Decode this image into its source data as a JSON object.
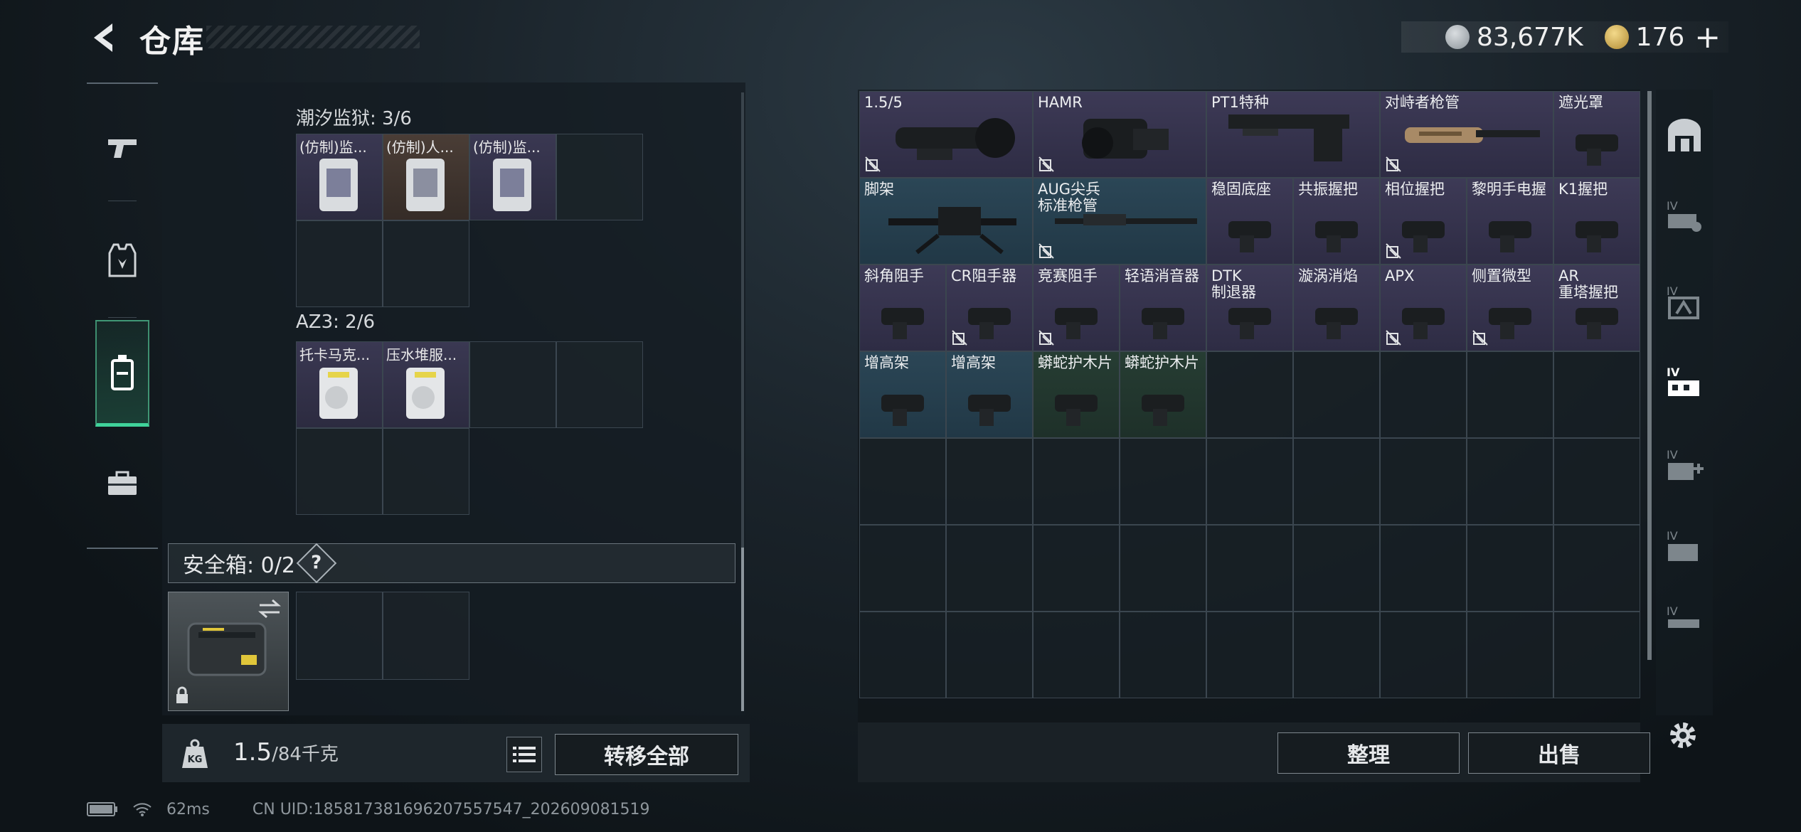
{
  "header": {
    "title": "仓库",
    "currency_1": "83,677K",
    "currency_2": "176",
    "plus": "+"
  },
  "left_rail": {
    "items": [
      {
        "name": "weapons",
        "icon": "pistol-icon"
      },
      {
        "name": "equipment",
        "icon": "vest-icon"
      },
      {
        "name": "backpack",
        "icon": "backpack-icon",
        "active": true
      },
      {
        "name": "cases",
        "icon": "toolbox-icon"
      }
    ]
  },
  "storage": {
    "section_1": {
      "title": "潮汐监狱: 3/6",
      "items": [
        {
          "label": "(仿制)监..."
        },
        {
          "label": "(仿制)人..."
        },
        {
          "label": "(仿制)监..."
        }
      ]
    },
    "section_2": {
      "title": "AZ3: 2/6",
      "items": [
        {
          "label": "托卡马克..."
        },
        {
          "label": "压水堆服..."
        }
      ]
    },
    "safe_box": {
      "label": "安全箱: 0/2",
      "help": "?"
    }
  },
  "footer_left": {
    "weight": "1.5",
    "capacity": "/84千克",
    "transfer_all": "转移全部"
  },
  "status": {
    "ping": "62ms",
    "uid": "CN UID:185817381696207557547_202609081519"
  },
  "inventory": {
    "items": [
      {
        "label": "1.5/5",
        "color": "purple",
        "span": 2,
        "locked": true
      },
      {
        "label": "HAMR",
        "color": "purple",
        "span": 2,
        "locked": true
      },
      {
        "label": "PT1特种",
        "color": "purple",
        "span": 2,
        "locked": false
      },
      {
        "label": "对峙者枪管",
        "color": "purple",
        "span": 2,
        "locked": true
      },
      {
        "label": "遮光罩",
        "color": "purple",
        "span": 1,
        "locked": false
      },
      {
        "label": "脚架",
        "color": "blue",
        "span": 2,
        "locked": false
      },
      {
        "label": "AUG尖兵\n标准枪管",
        "color": "blue",
        "span": 2,
        "locked": true
      },
      {
        "label": "稳固底座",
        "color": "purple",
        "span": 1,
        "locked": false
      },
      {
        "label": "共振握把",
        "color": "purple",
        "span": 1,
        "locked": false
      },
      {
        "label": "相位握把",
        "color": "purple",
        "span": 1,
        "locked": true
      },
      {
        "label": "黎明手电握",
        "color": "purple",
        "span": 1,
        "locked": false
      },
      {
        "label": "K1握把",
        "color": "purple",
        "span": 1,
        "locked": false
      },
      {
        "label": "斜角阻手",
        "color": "purple",
        "span": 1,
        "locked": false
      },
      {
        "label": "CR阻手器",
        "color": "purple",
        "span": 1,
        "locked": true
      },
      {
        "label": "竞赛阻手",
        "color": "purple",
        "span": 1,
        "locked": true
      },
      {
        "label": "轻语消音器",
        "color": "purple",
        "span": 1,
        "locked": false
      },
      {
        "label": "DTK\n制退器",
        "color": "purple",
        "span": 1,
        "locked": false
      },
      {
        "label": "漩涡消焰",
        "color": "purple",
        "span": 1,
        "locked": false
      },
      {
        "label": "APX",
        "color": "purple",
        "span": 1,
        "locked": true
      },
      {
        "label": "侧置微型",
        "color": "purple",
        "span": 1,
        "locked": true
      },
      {
        "label": "AR\n重塔握把",
        "color": "purple",
        "span": 1,
        "locked": false
      },
      {
        "label": "增高架",
        "color": "blue",
        "span": 1,
        "locked": false
      },
      {
        "label": "增高架",
        "color": "blue",
        "span": 1,
        "locked": false
      },
      {
        "label": "蟒蛇护木片",
        "color": "green",
        "span": 1,
        "locked": false
      },
      {
        "label": "蟒蛇护木片",
        "color": "green",
        "span": 1,
        "locked": false
      }
    ],
    "sort": "整理",
    "sell": "出售"
  },
  "colors": {
    "accent_green": "#3fd29a",
    "rarity_purple": "#3d3a56",
    "rarity_blue": "#2b4656",
    "rarity_green": "#263d33"
  }
}
